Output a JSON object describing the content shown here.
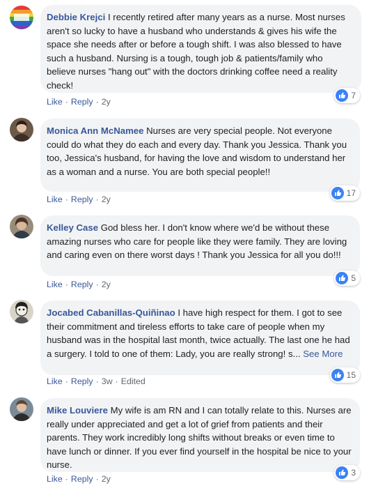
{
  "colors": {
    "author_link": "#385898",
    "bubble_bg": "#f2f3f5",
    "like_blue": "#3b82f6",
    "meta_gray": "#606770"
  },
  "actions": {
    "like_label": "Like",
    "reply_label": "Reply",
    "separator": "·",
    "see_more_label": "See More",
    "edited_label": "Edited"
  },
  "comments": [
    {
      "author": "Debbie Krejci",
      "text": "I recently retired after many years as a nurse. Most nurses aren't so lucky to have a husband who understands & gives his wife the space she needs after or before a tough shift. I was also blessed to have such a husband. Nursing is a tough, tough job & patients/family who believe nurses \"hang out\" with the doctors drinking coffee need a reality check!",
      "time": "2y",
      "reactions": "7",
      "avatar_icon": "rainbow-flag-avatar-icon"
    },
    {
      "author": "Monica Ann McNamee",
      "text": "Nurses are very special people. Not everyone could do what they do each and every day. Thank you Jessica. Thank you too, Jessica's husband, for having the love and wisdom to understand her as a woman and a nurse. You are both special people!!",
      "time": "2y",
      "reactions": "17",
      "avatar_icon": "person-photo-avatar-icon"
    },
    {
      "author": "Kelley Case",
      "text": "God bless her. I don't know where we'd be without these amazing nurses who care for people like they were family. They are loving and caring even on there worst days ! Thank you Jessica for all you do!!!",
      "time": "2y",
      "reactions": "5",
      "avatar_icon": "person-photo-avatar-icon"
    },
    {
      "author": "Jocabed Cabanillas-Quiñinao",
      "text": "I have high respect for them. I got to see their commitment and tireless efforts to take care of people when my husband was in the hospital last month, twice actually. The last one he had a surgery. I told to one of them: Lady, you are really strong! s...",
      "time": "3w",
      "reactions": "15",
      "avatar_icon": "illustration-avatar-icon"
    },
    {
      "author": "Mike Louviere",
      "text": "My wife is am RN and I can totally relate to this. Nurses are really under appreciated and get a lot of grief from patients and their parents. They work incredibly long shifts without breaks or even time to have lunch or dinner. If you ever find yourself in the hospital be nice to your nurse.",
      "time": "2y",
      "reactions": "3",
      "avatar_icon": "person-photo-avatar-icon"
    }
  ]
}
